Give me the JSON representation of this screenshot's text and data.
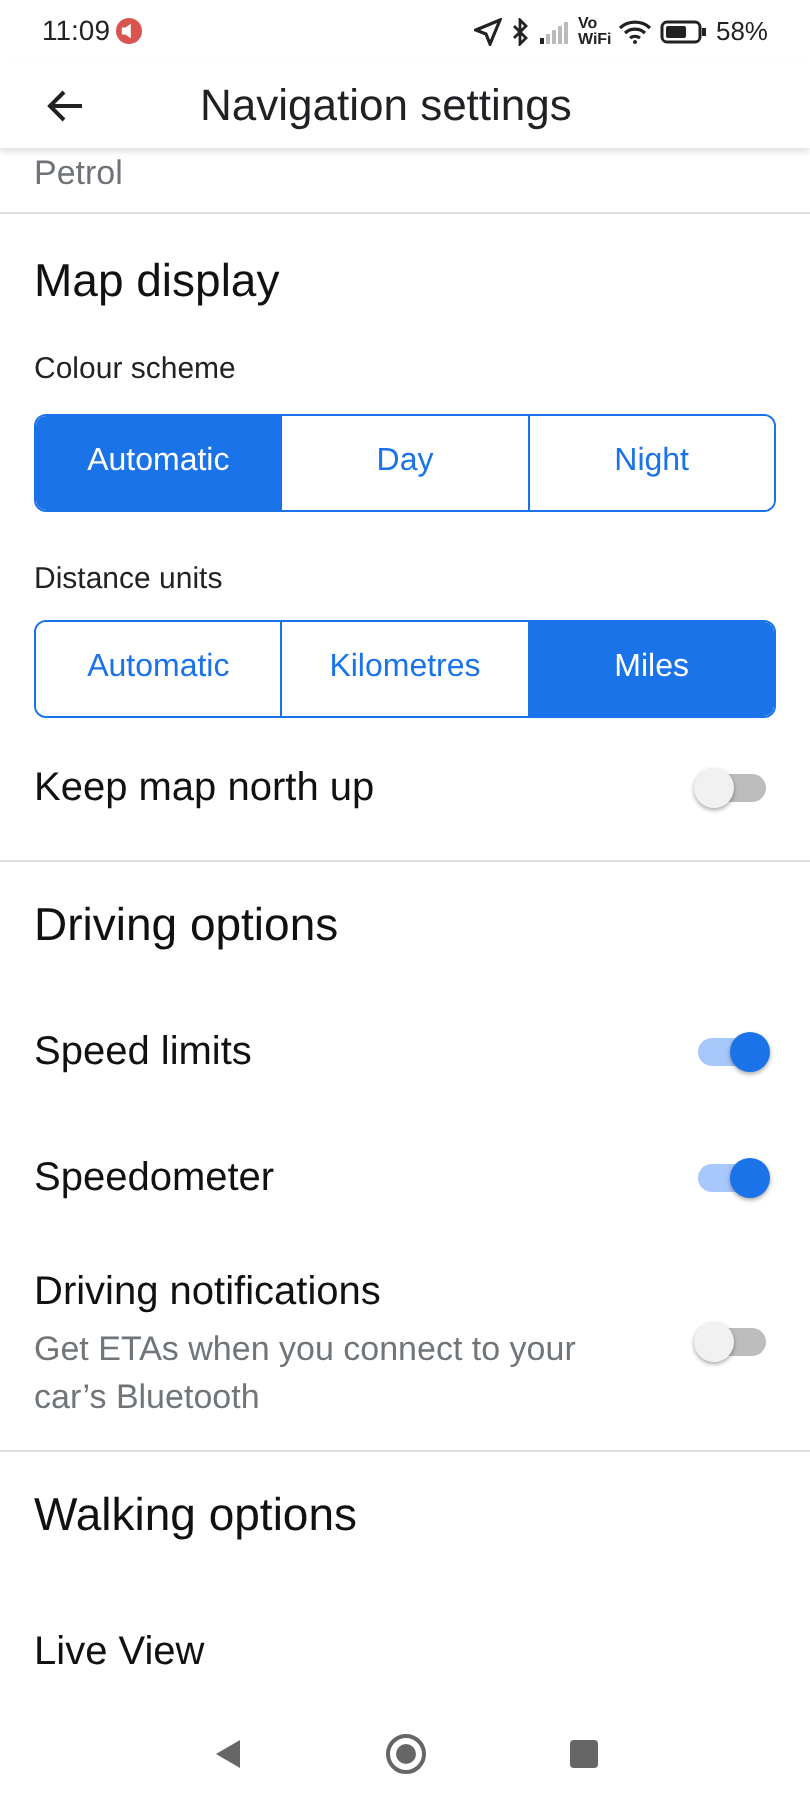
{
  "status_bar": {
    "time": "11:09",
    "network_label": "Vo WiFi",
    "battery": "58%"
  },
  "app_bar": {
    "title": "Navigation settings"
  },
  "partial_item": "Petrol",
  "map_display": {
    "heading": "Map display",
    "colour_scheme": {
      "label": "Colour scheme",
      "options": [
        {
          "label": "Automatic",
          "selected": true
        },
        {
          "label": "Day",
          "selected": false
        },
        {
          "label": "Night",
          "selected": false
        }
      ]
    },
    "distance_units": {
      "label": "Distance units",
      "options": [
        {
          "label": "Automatic",
          "selected": false
        },
        {
          "label": "Kilometres",
          "selected": false
        },
        {
          "label": "Miles",
          "selected": true
        }
      ]
    },
    "toggles": [
      {
        "label": "Keep map north up",
        "on": false
      }
    ]
  },
  "driving_options": {
    "heading": "Driving options",
    "toggles": [
      {
        "label": "Speed limits",
        "on": true
      },
      {
        "label": "Speedometer",
        "on": true
      },
      {
        "label": "Driving notifications",
        "description": "Get ETAs when you connect to your car’s Bluetooth",
        "on": false
      }
    ]
  },
  "walking_options": {
    "heading": "Walking options",
    "items": [
      {
        "label": "Live View"
      }
    ]
  }
}
